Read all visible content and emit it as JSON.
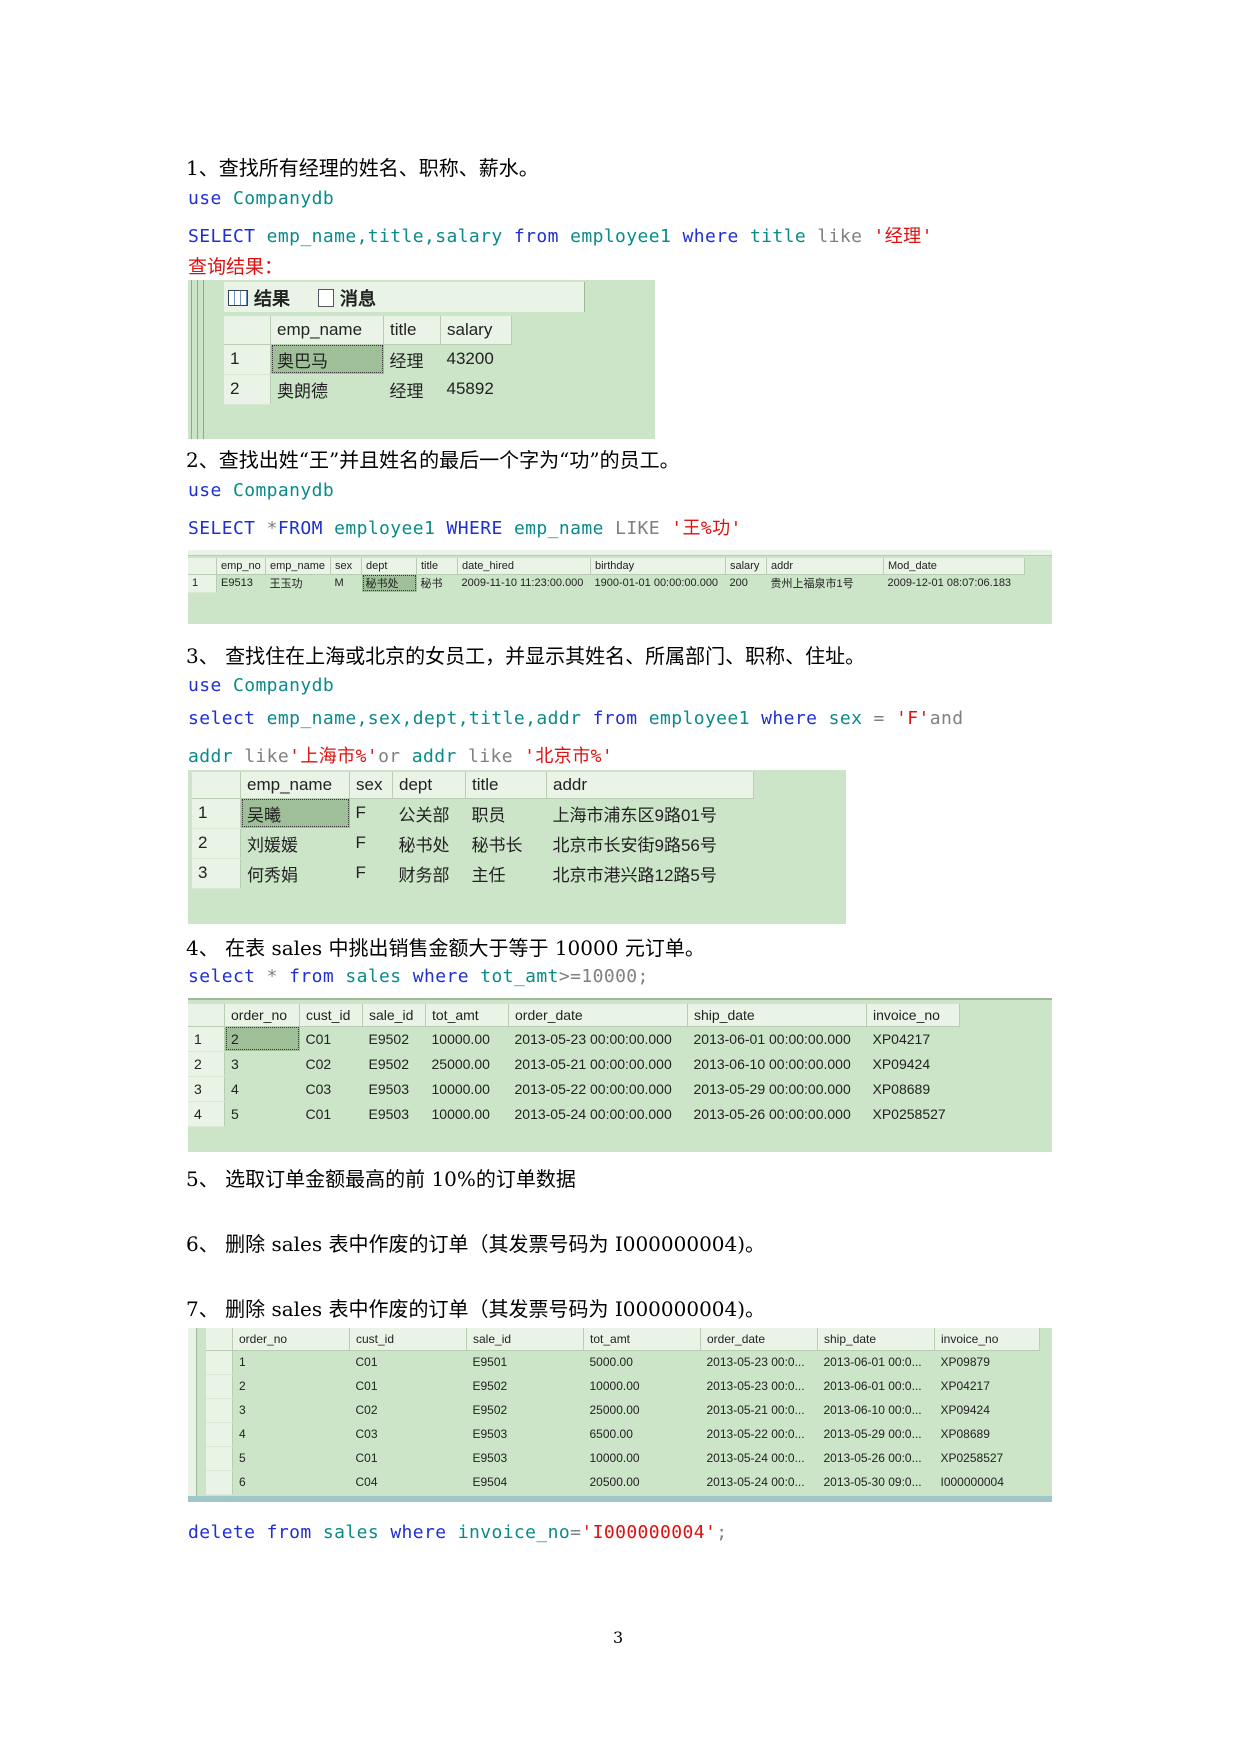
{
  "q1": {
    "heading": "1、查找所有经理的姓名、职称、薪水。",
    "use": [
      "use",
      "Companydb"
    ],
    "sql": [
      {
        "t": "SELECT",
        "c": "kw"
      },
      {
        "t": " ",
        "c": "black"
      },
      {
        "t": "emp_name,title,salary",
        "c": "id"
      },
      {
        "t": " ",
        "c": "black"
      },
      {
        "t": "from",
        "c": "kw"
      },
      {
        "t": " ",
        "c": "black"
      },
      {
        "t": "employee1",
        "c": "id"
      },
      {
        "t": " ",
        "c": "black"
      },
      {
        "t": "where",
        "c": "kw"
      },
      {
        "t": " ",
        "c": "black"
      },
      {
        "t": "title",
        "c": "id"
      },
      {
        "t": " like ",
        "c": "gray"
      },
      {
        "t": "'经理'",
        "c": "str"
      }
    ],
    "result_label": "查询结果：",
    "tabs": [
      "结果",
      "消息"
    ],
    "columns": [
      "emp_name",
      "title",
      "salary"
    ],
    "rows": [
      [
        "1",
        "奥巴马",
        "经理",
        "43200"
      ],
      [
        "2",
        "奥朗德",
        "经理",
        "45892"
      ]
    ]
  },
  "q2": {
    "heading": "2、查找出姓“王”并且姓名的最后一个字为“功”的员工。",
    "use": [
      "use",
      "Companydb"
    ],
    "sql": [
      {
        "t": "SELECT",
        "c": "kw"
      },
      {
        "t": " *",
        "c": "gray"
      },
      {
        "t": "FROM",
        "c": "kw"
      },
      {
        "t": " ",
        "c": "black"
      },
      {
        "t": "employee1",
        "c": "id"
      },
      {
        "t": " ",
        "c": "black"
      },
      {
        "t": "WHERE",
        "c": "kw"
      },
      {
        "t": " ",
        "c": "black"
      },
      {
        "t": "emp_name",
        "c": "id"
      },
      {
        "t": " LIKE ",
        "c": "gray"
      },
      {
        "t": "'王%功'",
        "c": "str"
      }
    ],
    "columns": [
      "emp_no",
      "emp_name",
      "sex",
      "dept",
      "title",
      "date_hired",
      "birthday",
      "salary",
      "addr",
      "Mod_date"
    ],
    "rows": [
      [
        "1",
        "E9513",
        "王玉功",
        "M",
        "秘书处",
        "秘书",
        "2009-11-10 11:23:00.000",
        "1900-01-01 00:00:00.000",
        "200",
        "贵州上福泉市1号",
        "2009-12-01 08:07:06.183"
      ]
    ]
  },
  "q3": {
    "heading": "3、 查找住在上海或北京的女员工，并显示其姓名、所属部门、职称、住址。",
    "use": [
      "use",
      "Companydb"
    ],
    "sql_line1": [
      {
        "t": "select",
        "c": "kw"
      },
      {
        "t": " ",
        "c": "black"
      },
      {
        "t": "emp_name,sex,dept,title,addr",
        "c": "id"
      },
      {
        "t": " ",
        "c": "black"
      },
      {
        "t": "from",
        "c": "kw"
      },
      {
        "t": " ",
        "c": "black"
      },
      {
        "t": "employee1",
        "c": "id"
      },
      {
        "t": " ",
        "c": "black"
      },
      {
        "t": "where",
        "c": "kw"
      },
      {
        "t": " ",
        "c": "black"
      },
      {
        "t": "sex",
        "c": "id"
      },
      {
        "t": " = ",
        "c": "gray"
      },
      {
        "t": "'F'",
        "c": "str"
      },
      {
        "t": "and",
        "c": "gray"
      }
    ],
    "sql_line2": [
      {
        "t": "addr",
        "c": "id"
      },
      {
        "t": " like",
        "c": "gray"
      },
      {
        "t": "'上海市%'",
        "c": "str"
      },
      {
        "t": "or",
        "c": "gray"
      },
      {
        "t": " ",
        "c": "black"
      },
      {
        "t": "addr",
        "c": "id"
      },
      {
        "t": " like ",
        "c": "gray"
      },
      {
        "t": "'北京市%'",
        "c": "str"
      }
    ],
    "columns": [
      "emp_name",
      "sex",
      "dept",
      "title",
      "addr"
    ],
    "rows": [
      [
        "1",
        "吴曦",
        "F",
        "公关部",
        "职员",
        "上海市浦东区9路01号"
      ],
      [
        "2",
        "刘媛媛",
        "F",
        "秘书处",
        "秘书长",
        "北京市长安街9路56号"
      ],
      [
        "3",
        "何秀娟",
        "F",
        "财务部",
        "主任",
        "北京市港兴路12路5号"
      ]
    ]
  },
  "q4": {
    "heading": "4、 在表 sales 中挑出销售金额大于等于 10000 元订单。",
    "sql": [
      {
        "t": "select",
        "c": "kw"
      },
      {
        "t": " * ",
        "c": "gray"
      },
      {
        "t": "from",
        "c": "kw"
      },
      {
        "t": " ",
        "c": "black"
      },
      {
        "t": "sales",
        "c": "id"
      },
      {
        "t": " ",
        "c": "black"
      },
      {
        "t": "where",
        "c": "kw"
      },
      {
        "t": " ",
        "c": "black"
      },
      {
        "t": "tot_amt",
        "c": "id"
      },
      {
        "t": ">=10000;",
        "c": "gray"
      }
    ],
    "columns": [
      "order_no",
      "cust_id",
      "sale_id",
      "tot_amt",
      "order_date",
      "ship_date",
      "invoice_no"
    ],
    "rows": [
      [
        "1",
        "2",
        "C01",
        "E9502",
        "10000.00",
        "2013-05-23 00:00:00.000",
        "2013-06-01 00:00:00.000",
        "XP04217"
      ],
      [
        "2",
        "3",
        "C02",
        "E9502",
        "25000.00",
        "2013-05-21 00:00:00.000",
        "2013-06-10 00:00:00.000",
        "XP09424"
      ],
      [
        "3",
        "4",
        "C03",
        "E9503",
        "10000.00",
        "2013-05-22 00:00:00.000",
        "2013-05-29 00:00:00.000",
        "XP08689"
      ],
      [
        "4",
        "5",
        "C01",
        "E9503",
        "10000.00",
        "2013-05-24 00:00:00.000",
        "2013-05-26 00:00:00.000",
        "XP0258527"
      ]
    ]
  },
  "q5": {
    "heading": "5、 选取订单金额最高的前 10%的订单数据"
  },
  "q6": {
    "heading": "6、 删除 sales 表中作废的订单（其发票号码为 I000000004)。"
  },
  "q7": {
    "heading": "7、 删除 sales 表中作废的订单（其发票号码为 I000000004)。",
    "columns": [
      "order_no",
      "cust_id",
      "sale_id",
      "tot_amt",
      "order_date",
      "ship_date",
      "invoice_no"
    ],
    "rows": [
      [
        "1",
        "C01",
        "E9501",
        "5000.00",
        "2013-05-23 00:0...",
        "2013-06-01 00:0...",
        "XP09879"
      ],
      [
        "2",
        "C01",
        "E9502",
        "10000.00",
        "2013-05-23 00:0...",
        "2013-06-01 00:0...",
        "XP04217"
      ],
      [
        "3",
        "C02",
        "E9502",
        "25000.00",
        "2013-05-21 00:0...",
        "2013-06-10 00:0...",
        "XP09424"
      ],
      [
        "4",
        "C03",
        "E9503",
        "6500.00",
        "2013-05-22 00:0...",
        "2013-05-29 00:0...",
        "XP08689"
      ],
      [
        "5",
        "C01",
        "E9503",
        "10000.00",
        "2013-05-24 00:0...",
        "2013-05-26 00:0...",
        "XP0258527"
      ],
      [
        "6",
        "C04",
        "E9504",
        "20500.00",
        "2013-05-24 00:0...",
        "2013-05-30 09:0...",
        "I000000004"
      ]
    ],
    "sql": [
      {
        "t": "delete",
        "c": "kw"
      },
      {
        "t": " ",
        "c": "black"
      },
      {
        "t": "from",
        "c": "kw"
      },
      {
        "t": " ",
        "c": "black"
      },
      {
        "t": "sales",
        "c": "id"
      },
      {
        "t": " ",
        "c": "black"
      },
      {
        "t": "where",
        "c": "kw"
      },
      {
        "t": " ",
        "c": "black"
      },
      {
        "t": "invoice_no",
        "c": "id"
      },
      {
        "t": "=",
        "c": "gray"
      },
      {
        "t": "'I000000004'",
        "c": "str"
      },
      {
        "t": ";",
        "c": "gray"
      }
    ]
  },
  "colors": {
    "keyword": "#1f2fd0",
    "identifier": "#0a8a8a",
    "operator": "#808080",
    "string": "#e01010",
    "panel": "#cce5c8"
  },
  "page_number": "3"
}
